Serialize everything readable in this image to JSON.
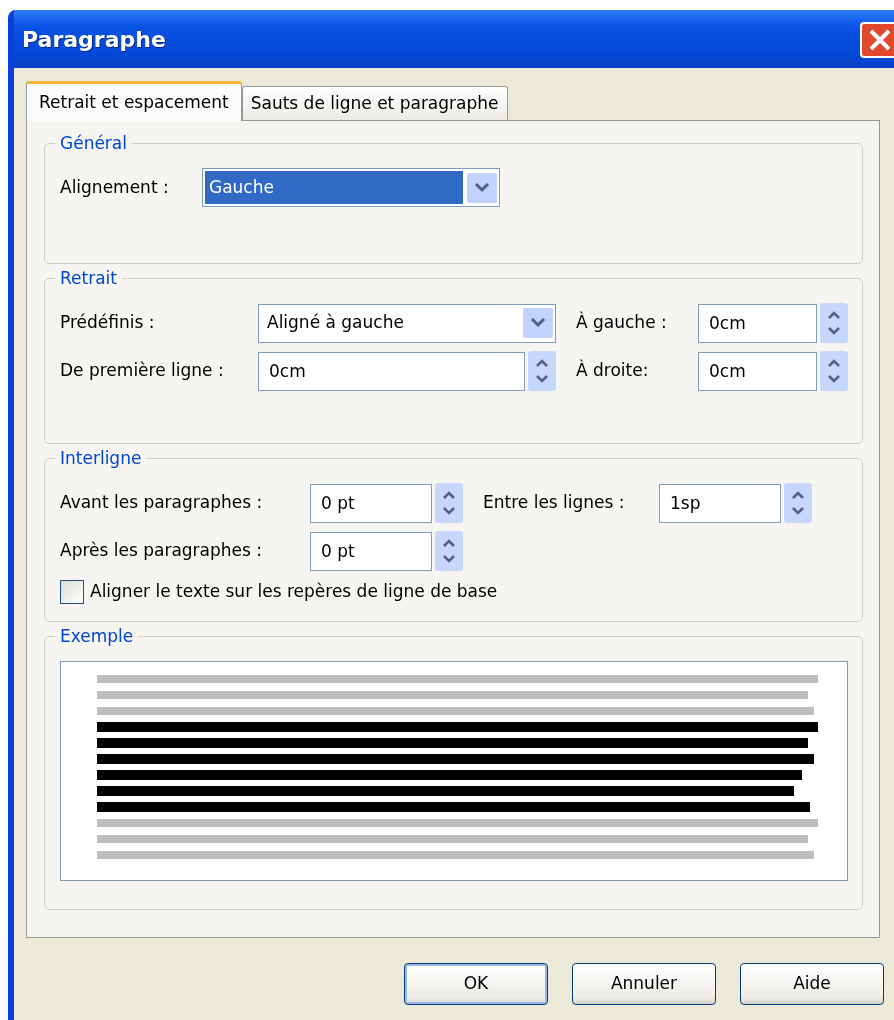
{
  "window": {
    "title": "Paragraphe"
  },
  "tabs": [
    {
      "label": "Retrait et espacement",
      "selected": true
    },
    {
      "label": "Sauts de ligne et paragraphe",
      "selected": false
    }
  ],
  "groups": [
    {
      "title": "Général",
      "rows": [
        [
          {
            "kind": "select",
            "label": "Alignement :",
            "value": "Gauche",
            "highlighted": true
          }
        ]
      ]
    },
    {
      "title": "Retrait",
      "rows": [
        [
          {
            "kind": "select",
            "label": "Prédéfinis :",
            "value": "Aligné à gauche",
            "highlighted": false
          },
          {
            "kind": "spin",
            "label": "À gauche :",
            "value": "0cm"
          }
        ],
        [
          {
            "kind": "spin",
            "label": "De première ligne :",
            "value": "0cm"
          },
          {
            "kind": "spin",
            "label": "À droite:",
            "value": "0cm"
          }
        ]
      ]
    },
    {
      "title": "Interligne",
      "rows": [
        [
          {
            "kind": "spin",
            "label": "Avant les paragraphes :",
            "value": "0 pt"
          },
          {
            "kind": "spin",
            "label": "Entre les lignes :",
            "value": "1sp"
          }
        ],
        [
          {
            "kind": "spin",
            "label": "Après les paragraphes :",
            "value": "0 pt"
          }
        ],
        [
          {
            "kind": "checkbox",
            "label": "Aligner le texte sur les repères de ligne de base",
            "checked": false
          }
        ]
      ]
    },
    {
      "title": "Exemple",
      "rows": [
        [
          {
            "kind": "preview"
          }
        ]
      ]
    }
  ],
  "buttons": [
    {
      "label": "OK",
      "default": true
    },
    {
      "label": "Annuler",
      "default": false
    },
    {
      "label": "Aide",
      "default": false
    }
  ]
}
